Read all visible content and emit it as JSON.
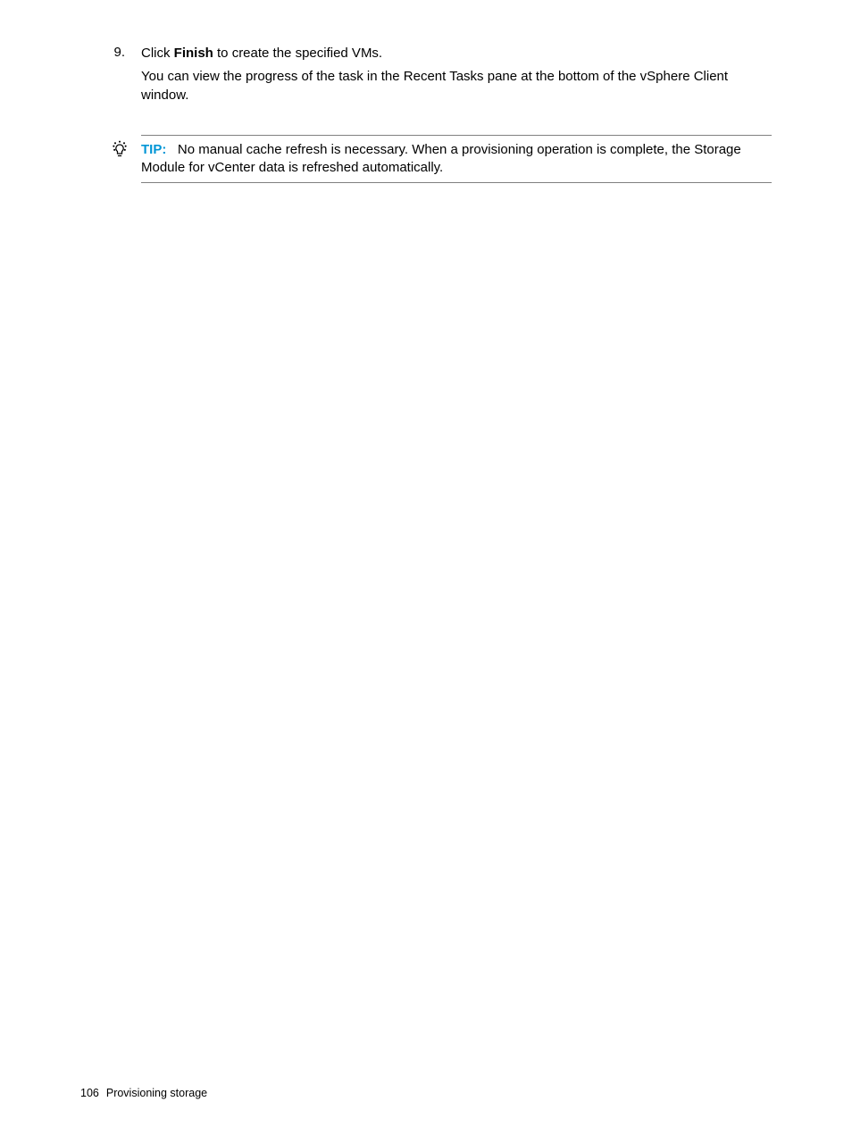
{
  "step": {
    "number": "9.",
    "instruction_prefix": "Click ",
    "instruction_bold": "Finish",
    "instruction_suffix": " to create the specified VMs.",
    "detail": "You can view the progress of the task in the Recent Tasks pane at the bottom of the vSphere Client window."
  },
  "tip": {
    "label": "TIP:",
    "text": "No manual cache refresh is necessary. When a provisioning operation is complete, the Storage Module for vCenter data is refreshed automatically."
  },
  "footer": {
    "page_number": "106",
    "section": "Provisioning storage"
  }
}
